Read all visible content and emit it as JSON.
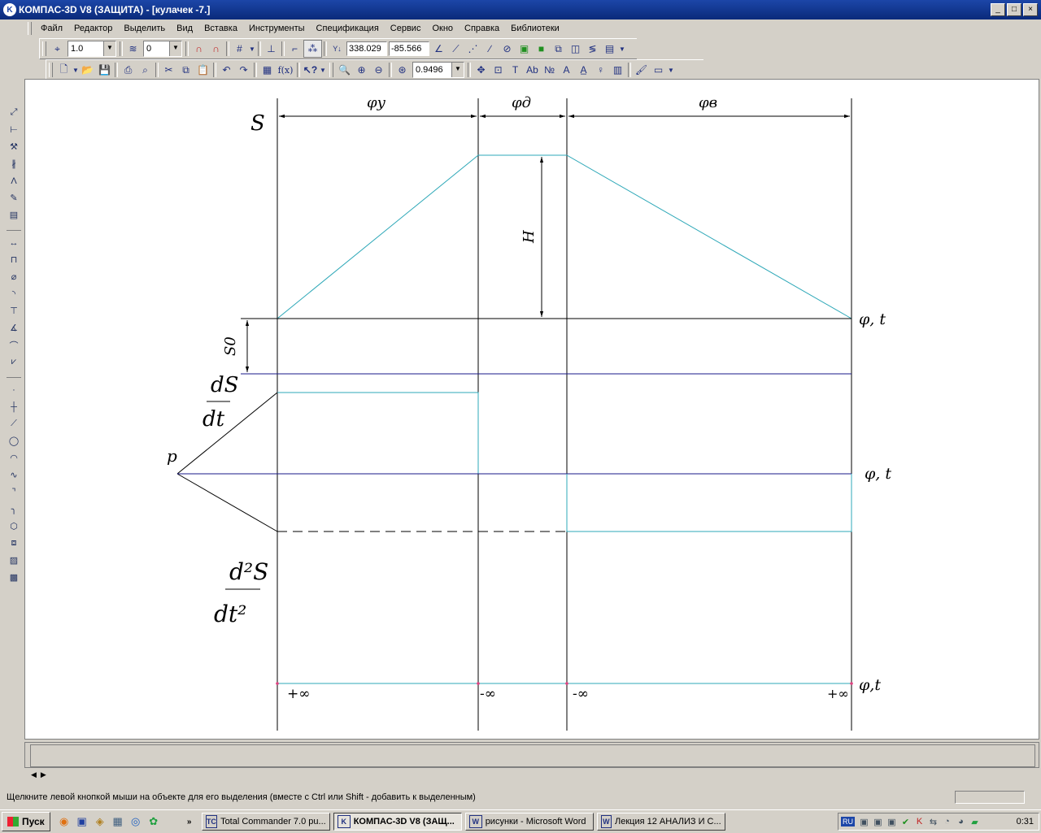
{
  "window": {
    "title": "КОМПАС-3D V8 (ЗАЩИТА) - [кулачек -7.]",
    "controls": [
      "_",
      "□",
      "×"
    ]
  },
  "menu": [
    "Файл",
    "Редактор",
    "Выделить",
    "Вид",
    "Вставка",
    "Инструменты",
    "Спецификация",
    "Сервис",
    "Окно",
    "Справка",
    "Библиотеки"
  ],
  "toolbar1": {
    "step_value": "1.0",
    "layer_value": "0",
    "coord_x": "338.029",
    "coord_y": "-85.566"
  },
  "toolbar2": {
    "zoom_value": "0.9496",
    "fx_label": "f(x)"
  },
  "drawing": {
    "s_label": "S",
    "phi_u": "φу",
    "phi_d": "φд",
    "phi_v": "φв",
    "h_label": "H",
    "s0_label": "S0",
    "phi_t_1": "φ, t",
    "phi_t_2": "φ, t",
    "phi_t_3": "φ,t",
    "ds_num": "dS",
    "ds_den": "dt",
    "p_label": "p",
    "d2s_num": "d²S",
    "d2s_den": "dt²",
    "inf_1": "+∞",
    "inf_2": "-∞",
    "inf_3": "-∞",
    "inf_4": "+∞"
  },
  "status": {
    "message": "Щелкните левой кнопкой мыши на объекте для его выделения (вместе с Ctrl или Shift - добавить к выделенным)"
  },
  "taskbar": {
    "start_label": "Пуск",
    "tasks": [
      {
        "label": "Total Commander 7.0 pu...",
        "icon": "TC"
      },
      {
        "label": "КОМПАС-3D V8 (ЗАЩ...",
        "icon": "K"
      },
      {
        "label": "рисунки - Microsoft Word",
        "icon": "W"
      },
      {
        "label": "Лекция 12 АНАЛИЗ И С...",
        "icon": "W"
      }
    ],
    "lang": "RU",
    "clock": "0:31"
  },
  "colors": {
    "title_bar": "#0a2a7a",
    "curve_cyan": "#2ea8b8",
    "axis_blue": "#1a1a8a"
  }
}
